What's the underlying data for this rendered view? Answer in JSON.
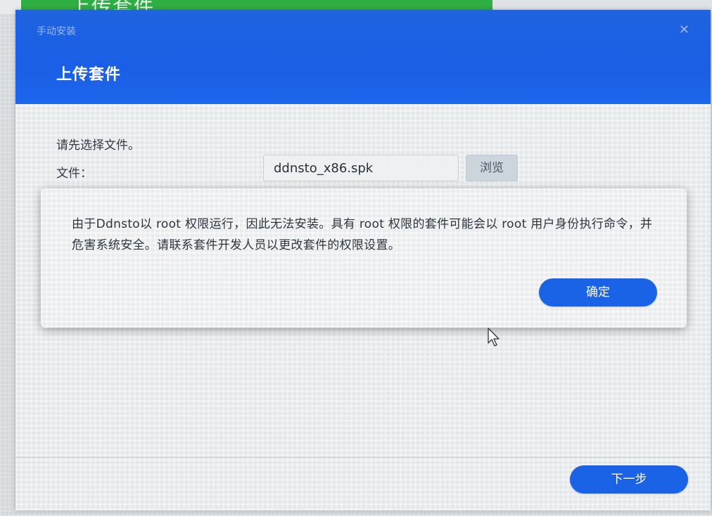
{
  "background": {
    "title": "上传套件"
  },
  "dialog": {
    "caption": "手动安装",
    "close_glyph": "✕",
    "heading": "上传套件",
    "prompt": "请先选择文件。",
    "file_label": "文件：",
    "file_value": "ddnsto_x86.spk",
    "browse_label": "浏览",
    "next_label": "下一步"
  },
  "alert": {
    "message": "由于Ddnsto以 root 权限运行，因此无法安装。具有 root 权限的套件可能会以 root 用户身份执行命令，并危害系统安全。请联系套件开发人员以更改套件的权限设置。",
    "ok_label": "确定"
  },
  "colors": {
    "header_blue": "#1a5fe6",
    "button_blue": "#1a63e6",
    "background_green": "#2fae43"
  },
  "icons": {
    "close": "close-icon",
    "cursor": "mouse-pointer-icon"
  }
}
